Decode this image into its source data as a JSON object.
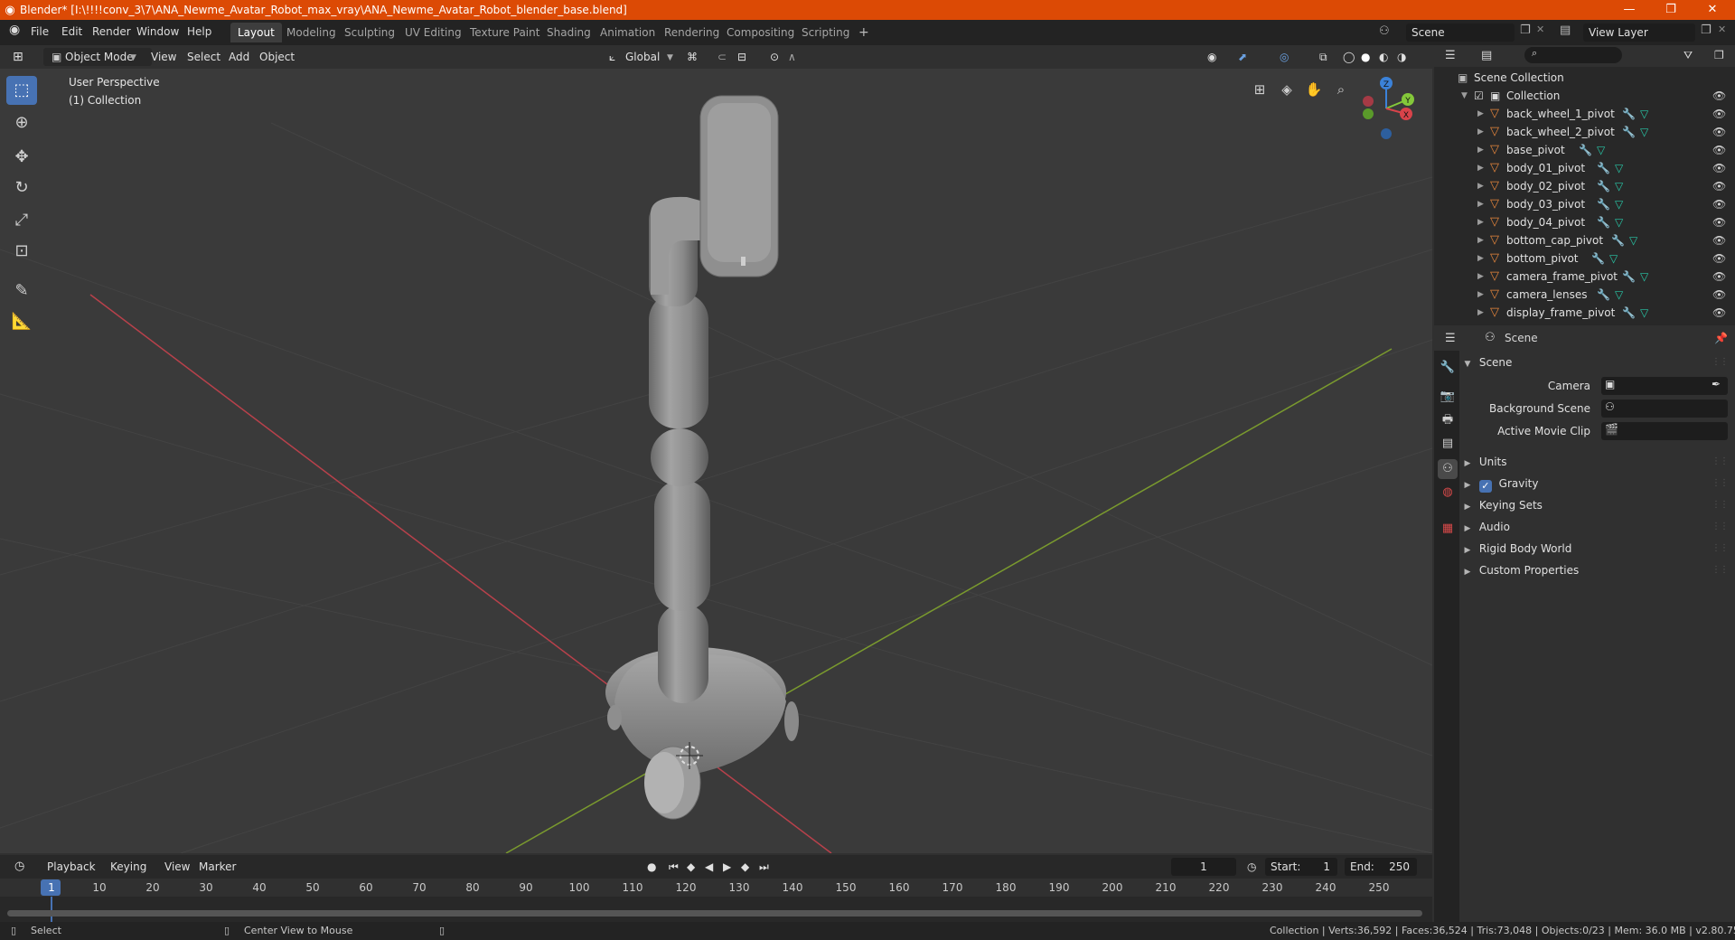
{
  "window": {
    "title": "Blender* [I:\\!!!!conv_3\\7\\ANA_Newme_Avatar_Robot_max_vray\\ANA_Newme_Avatar_Robot_blender_base.blend]",
    "minimize": "—",
    "maximize": "❐",
    "close": "✕"
  },
  "menu": [
    "File",
    "Edit",
    "Render",
    "Window",
    "Help"
  ],
  "workspaces": [
    "Layout",
    "Modeling",
    "Sculpting",
    "UV Editing",
    "Texture Paint",
    "Shading",
    "Animation",
    "Rendering",
    "Compositing",
    "Scripting"
  ],
  "workspace_add": "+",
  "scene_selector": "Scene",
  "view_layer": "View Layer",
  "viewport_header": {
    "mode": "Object Mode",
    "menus": [
      "View",
      "Select",
      "Add",
      "Object"
    ],
    "orientation": "Global"
  },
  "viewport": {
    "perspective": "User Perspective",
    "collection": "(1) Collection",
    "gizmo_axes": [
      "Z",
      "Y",
      "X"
    ]
  },
  "outliner": {
    "root": "Scene Collection",
    "collection": "Collection",
    "items": [
      "back_wheel_1_pivot",
      "back_wheel_2_pivot",
      "base_pivot",
      "body_01_pivot",
      "body_02_pivot",
      "body_03_pivot",
      "body_04_pivot",
      "bottom_cap_pivot",
      "bottom_pivot",
      "camera_frame_pivot",
      "camera_lenses",
      "display_frame_pivot"
    ]
  },
  "properties": {
    "context": "Scene",
    "panel": "Scene",
    "fields": {
      "camera": "Camera",
      "background_scene": "Background Scene",
      "active_movie_clip": "Active Movie Clip"
    },
    "subpanels": [
      "Units",
      "Gravity",
      "Keying Sets",
      "Audio",
      "Rigid Body World",
      "Custom Properties"
    ],
    "gravity_checked": true
  },
  "timeline": {
    "menus": [
      "Playback",
      "Keying",
      "View",
      "Marker"
    ],
    "current_frame": "1",
    "start_label": "Start:",
    "start": "1",
    "end_label": "End:",
    "end": "250",
    "ticks": [
      "1",
      "10",
      "20",
      "30",
      "40",
      "50",
      "60",
      "70",
      "80",
      "90",
      "100",
      "110",
      "120",
      "130",
      "140",
      "150",
      "160",
      "170",
      "180",
      "190",
      "200",
      "210",
      "220",
      "230",
      "240",
      "250"
    ]
  },
  "statusbar": {
    "select": "Select",
    "center_view": "Center View to Mouse",
    "stats": "Collection | Verts:36,592 | Faces:36,524 | Tris:73,048 | Objects:0/23 | Mem: 36.0 MB | v2.80.75"
  },
  "colors": {
    "title_bar": "#dc4a05",
    "accent": "#4772b3",
    "object_icon": "#e8873c",
    "mesh_icon": "#28c9a8",
    "x_axis": "#d9434a",
    "y_axis": "#84c83a",
    "z_axis": "#3b82d9"
  }
}
